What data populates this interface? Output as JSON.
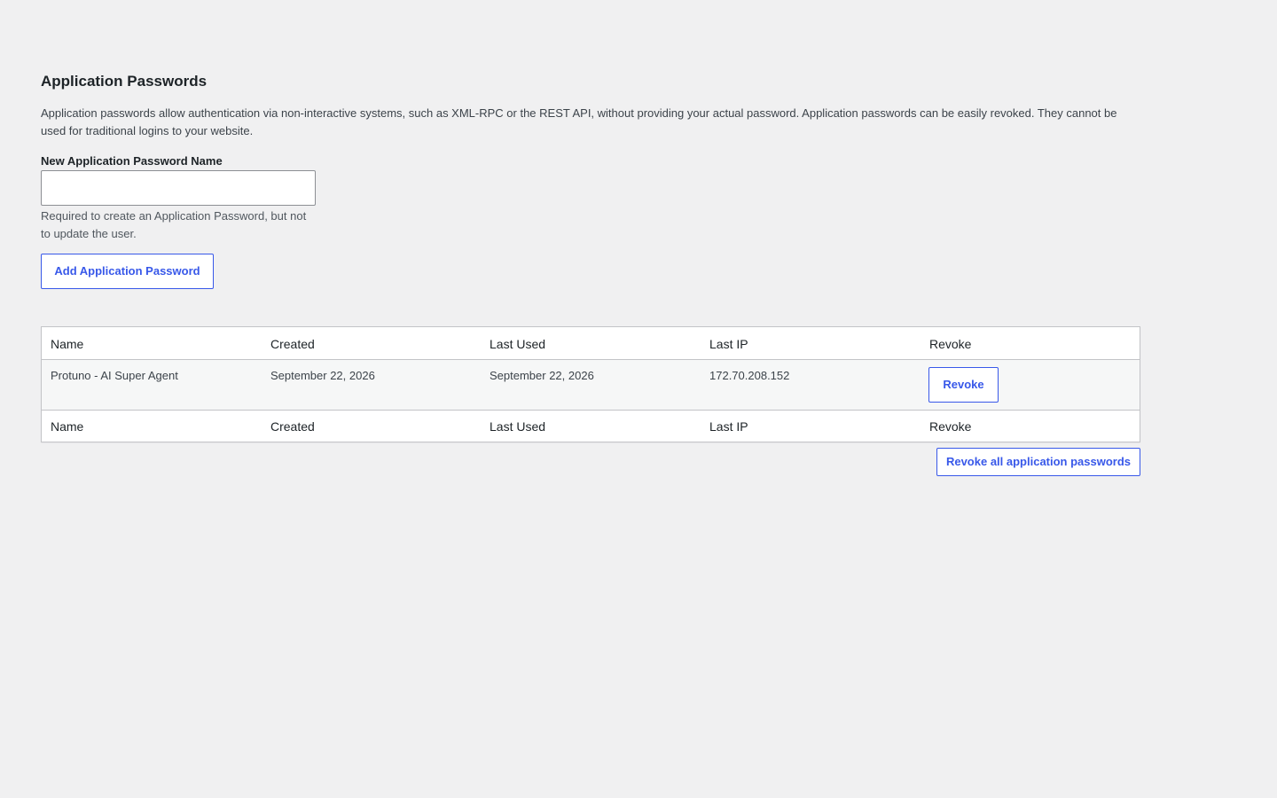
{
  "section": {
    "title": "Application Passwords",
    "description": "Application passwords allow authentication via non-interactive systems, such as XML-RPC or the REST API, without providing your actual password. Application passwords can be easily revoked. They cannot be used for traditional logins to your website."
  },
  "form": {
    "label": "New Application Password Name",
    "input_value": "",
    "input_placeholder": "",
    "help": "Required to create an Application Password, but not to update the user.",
    "add_button": "Add Application Password"
  },
  "table": {
    "columns": [
      "Name",
      "Created",
      "Last Used",
      "Last IP",
      "Revoke"
    ],
    "rows": [
      {
        "name": "Protuno - AI Super Agent",
        "created": "September 22, 2026",
        "last_used": "September 22, 2026",
        "last_ip": "172.70.208.152",
        "revoke_label": "Revoke"
      }
    ]
  },
  "revoke_all_button": "Revoke all application passwords",
  "colors": {
    "background": "#f0f0f1",
    "accent": "#3858e9",
    "border": "#c3c4c7"
  }
}
